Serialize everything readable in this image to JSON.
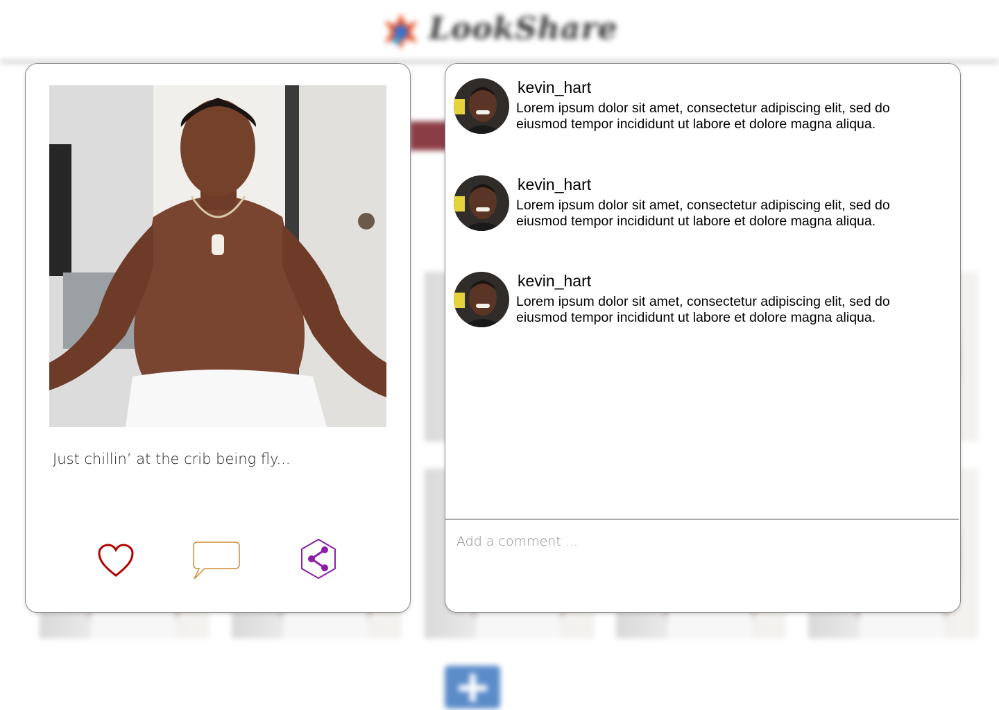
{
  "app": {
    "name": "LookShare"
  },
  "post": {
    "caption": "Just chillin’ at the crib being fly...",
    "actions": {
      "like_icon": "heart-icon",
      "comment_icon": "speech-bubble-icon",
      "share_icon": "share-icon"
    },
    "colors": {
      "like": "#b30000",
      "comment": "#d08a33",
      "share": "#8c1fa6"
    }
  },
  "comments": [
    {
      "username": "kevin_hart",
      "text": "Lorem ipsum dolor sit amet, consectetur adipiscing elit, sed do eiusmod tempor incididunt ut labore et dolore magna aliqua."
    },
    {
      "username": "kevin_hart",
      "text": "Lorem ipsum dolor sit amet, consectetur adipiscing elit, sed do eiusmod tempor incididunt ut labore et dolore magna aliqua."
    },
    {
      "username": "kevin_hart",
      "text": "Lorem ipsum dolor sit amet, consectetur adipiscing elit, sed do eiusmod tempor incididunt ut labore et dolore magna aliqua."
    }
  ],
  "comment_input": {
    "placeholder": "Add a comment ..."
  },
  "background": {
    "add_button_color": "#5b8bc9"
  }
}
